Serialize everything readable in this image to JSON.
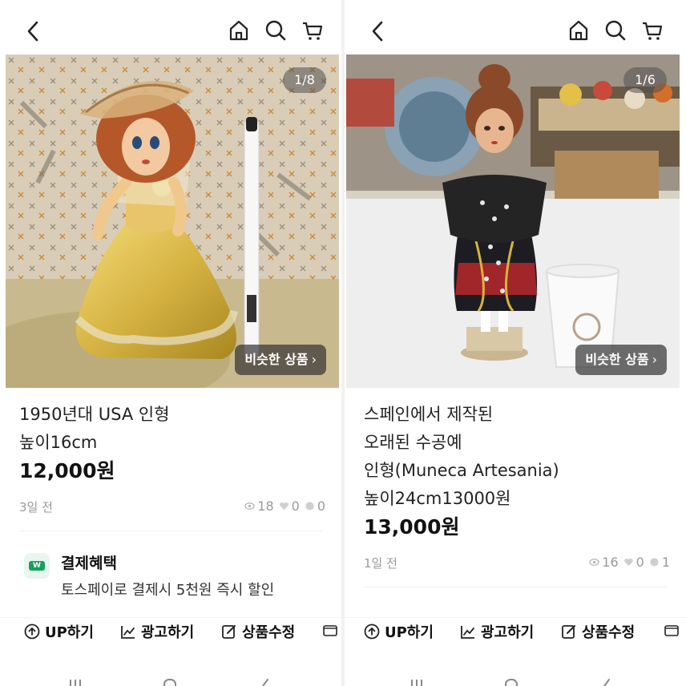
{
  "left": {
    "image_counter": "1/8",
    "similar_label": "비슷한 상품",
    "title_lines": [
      "1950년대 USA 인형",
      "높이16cm"
    ],
    "price": "12,000원",
    "posted": "3일 전",
    "stats": {
      "views": "18",
      "likes": "0",
      "chats": "0"
    },
    "benefit": {
      "title": "결제혜택",
      "description": "토스페이로 결제시 5천원 즉시 할인",
      "icon": "toss-pay-icon"
    },
    "actions": [
      "UP하기",
      "광고하기",
      "상품수정"
    ]
  },
  "right": {
    "image_counter": "1/6",
    "similar_label": "비슷한 상품",
    "title_lines": [
      "스페인에서 제작된",
      "오래된 수공예",
      "인형(Muneca Artesania)",
      "높이24cm13000원"
    ],
    "price": "13,000원",
    "posted": "1일 전",
    "stats": {
      "views": "16",
      "likes": "0",
      "chats": "1"
    },
    "actions": [
      "UP하기",
      "광고하기",
      "상품수정"
    ]
  },
  "icons": [
    "back-arrow-icon",
    "home-icon",
    "search-icon",
    "cart-icon",
    "eye-icon",
    "heart-icon",
    "chat-icon",
    "up-arrow-icon",
    "chart-icon",
    "edit-icon",
    "box-icon"
  ],
  "colors": {
    "accent": "#17a05d",
    "text": "#222222",
    "muted": "#999999"
  }
}
